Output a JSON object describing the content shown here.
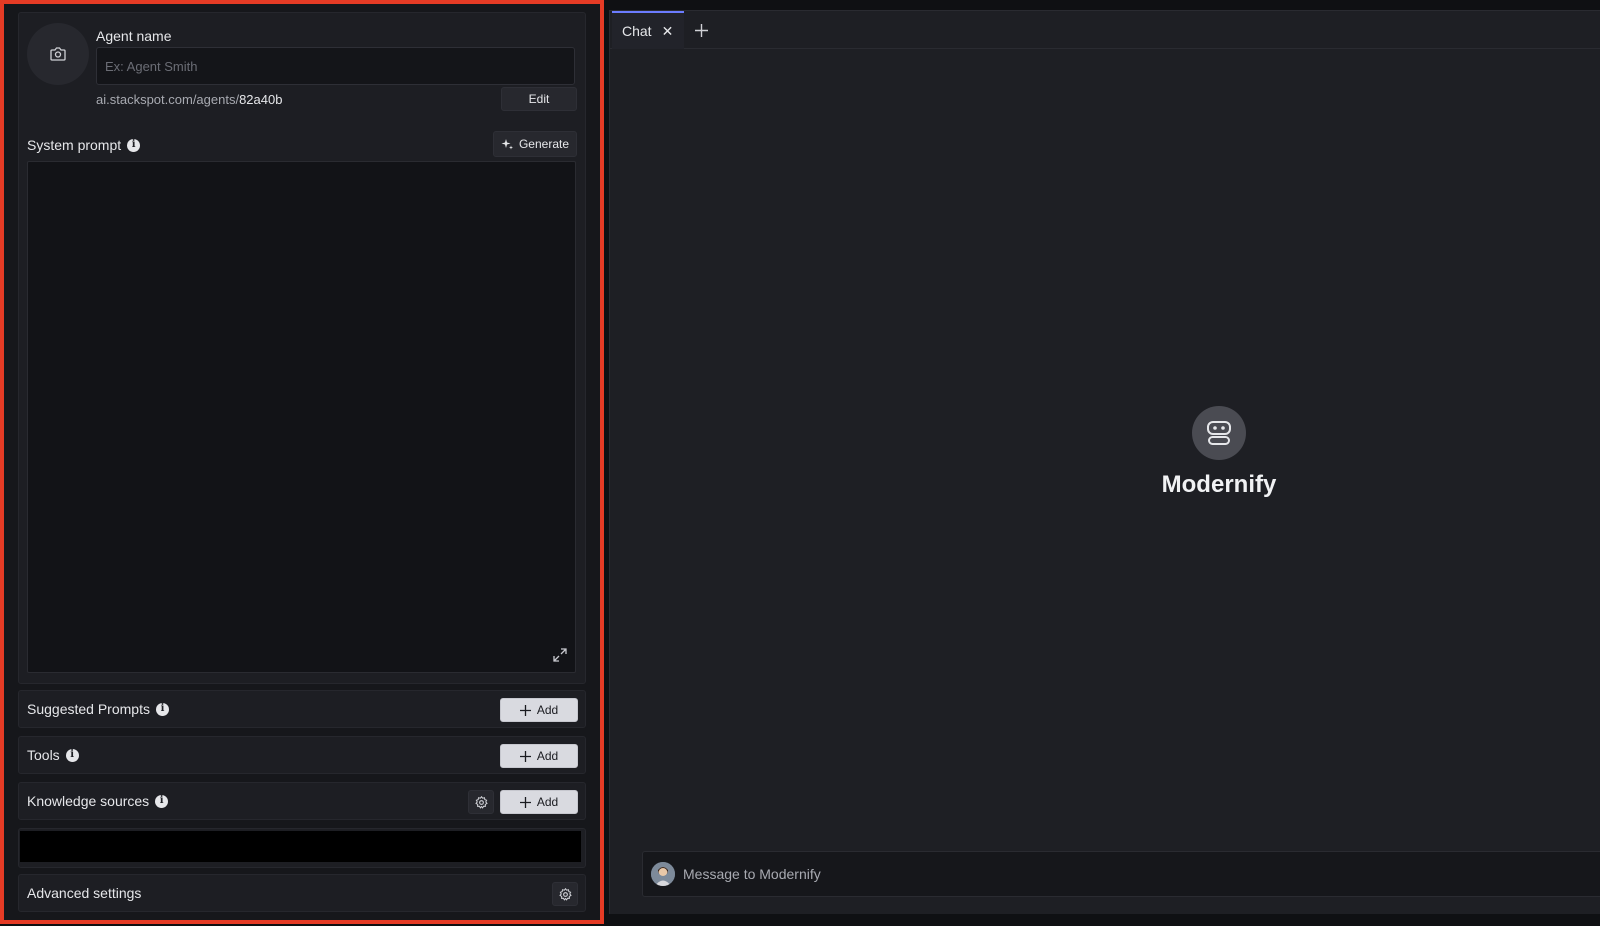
{
  "agent": {
    "name_label": "Agent name",
    "name_placeholder": "Ex: Agent Smith",
    "name_value": "",
    "url_prefix": "ai.stackspot.com/agents/",
    "url_slug": "82a40b",
    "edit_label": "Edit"
  },
  "system_prompt": {
    "label": "System prompt",
    "generate_label": "Generate",
    "value": ""
  },
  "sections": {
    "suggested_prompts": {
      "label": "Suggested Prompts",
      "add_label": "Add"
    },
    "tools": {
      "label": "Tools",
      "add_label": "Add"
    },
    "knowledge_sources": {
      "label": "Knowledge sources",
      "add_label": "Add"
    },
    "advanced_settings": {
      "label": "Advanced settings"
    }
  },
  "info_glyph": "i",
  "chat": {
    "tab_label": "Chat",
    "tab_close_glyph": "✕",
    "bot_name": "Modernify",
    "message_placeholder": "Message to Modernify"
  },
  "colors": {
    "highlight_border": "#e63b25",
    "tab_accent": "#6c7cff",
    "panel_bg": "#1d1e23"
  },
  "icons": {
    "avatar_upload": "camera-icon",
    "generate": "sparkle-icon",
    "expand": "expand-icon",
    "add": "plus-icon",
    "settings": "gear-icon",
    "info": "info-icon",
    "bot": "robot-icon"
  }
}
